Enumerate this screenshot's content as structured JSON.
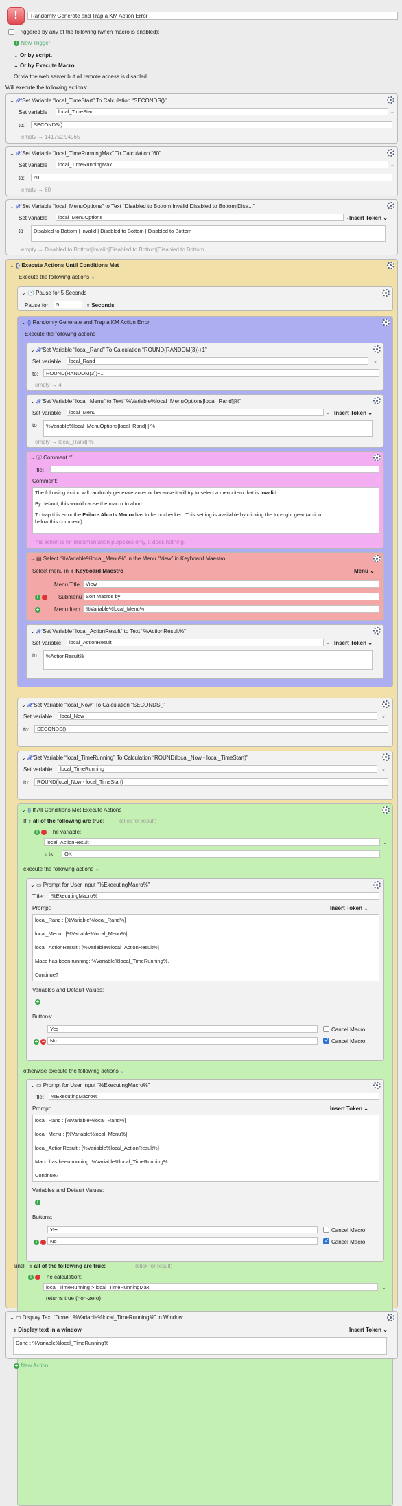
{
  "macro": {
    "name": "Randomly Generate and Trap a KM Action Error",
    "triggered_label": "Triggered by any of the following (when macro is enabled):",
    "new_trigger": "New Trigger",
    "or_by_script": "Or by script.",
    "or_by_execute": "Or by Execute Macro",
    "web_server_note": "Or via the web server but all remote access is disabled.",
    "will_execute": "Will execute the following actions:",
    "new_action": "New Action"
  },
  "actions": {
    "a1": {
      "title": "Set Variable “local_TimeStart” To Calculation “SECONDS()”",
      "set_label": "Set variable",
      "var": "local_TimeStart",
      "to_label": "to:",
      "value": "SECONDS()",
      "result": "empty → 141752.94965"
    },
    "a2": {
      "title": "Set Variable “local_TimeRunningMax” To Calculation “60”",
      "set_label": "Set variable",
      "var": "local_TimeRunningMax",
      "to_label": "to:",
      "value": "60",
      "result": "empty → 60"
    },
    "a3": {
      "title": "Set Variable “local_MenuOptions” to Text “Disabled to Bottom|Invalid|Disabled to Bottom|Disa...”",
      "set_label": "Set variable",
      "var": "local_MenuOptions",
      "insert": "Insert Token",
      "to_label": "to",
      "value": "Disabled to Bottom | Invalid | Disabled to Bottom | Disabled to Bottom",
      "result": "empty → Disabled to Bottom|Invalid|Disabled to Bottom|Disabled to Bottom"
    },
    "until": {
      "title": "Execute Actions Until Conditions Met",
      "exec_label": "Execute the following actions",
      "until_label": "until",
      "all_label": "all of the following are true:",
      "click": "(click for result)",
      "calc_label": "The calculation:",
      "calc": "local_TimeRunning > local_TimeRunningMax",
      "returns": "returns true (non-zero)"
    },
    "pause": {
      "title": "Pause for 5 Seconds",
      "label": "Pause for",
      "value": "5",
      "unit": "Seconds"
    },
    "group": {
      "title": "Randomly Generate and Trap a KM Action Error",
      "exec_label": "Execute the following actions"
    },
    "rand": {
      "title": "Set Variable “local_Rand” To Calculation “ROUND(RANDOM(3))+1”",
      "set_label": "Set variable",
      "var": "local_Rand",
      "to_label": "to:",
      "value": "ROUND(RANDOM(3))+1",
      "result": "empty → 4"
    },
    "menu": {
      "title": "Set Variable “local_Menu” to Text “%Variable%local_MenuOptions[local_Rand]|%”",
      "set_label": "Set variable",
      "var": "local_Menu",
      "insert": "Insert Token",
      "to_label": "to",
      "value": "%Variable%local_MenuOptions[local_Rand] | %",
      "result": "empty → local_Rand]|%"
    },
    "comment": {
      "title": "Comment “”",
      "title_label": "Title:",
      "comment_label": "Comment:",
      "line1_a": "The following action will randomly generate an error because it will try to select a menu item that is ",
      "line1_b": "Invalid",
      "line1_c": ".",
      "line2": "By default, this would cause the macro to abort.",
      "line3_a": "To trap this error the ",
      "line3_b": "Failure Aborts Macro",
      "line3_c": " has to be unchecked. This setting is available by clicking the top-right gear (action",
      "line3_d": "below this comment).",
      "footer": "This action is for documentation purposes only, it does nothing."
    },
    "select": {
      "title": "Select “%Variable%local_Menu%” in the Menu “View” in Keyboard Maestro",
      "select_label": "Select menu in",
      "app": "Keyboard Maestro",
      "menu_btn": "Menu",
      "title_label": "Menu Title",
      "title_val": "View",
      "sub_label": "Submenu",
      "sub_val": "Sort Macros by",
      "item_label": "Menu Item",
      "item_val": "%Variable%local_Menu%"
    },
    "result": {
      "title": "Set Variable “local_ActionResult” to Text “%ActionResult%”",
      "set_label": "Set variable",
      "var": "local_ActionResult",
      "insert": "Insert Token",
      "to_label": "to",
      "value": "%ActionResult%"
    },
    "now": {
      "title": "Set Variable “local_Now” To Calculation “SECONDS()”",
      "set_label": "Set variable",
      "var": "local_Now",
      "to_label": "to:",
      "value": "SECONDS()"
    },
    "running": {
      "title": "Set Variable “local_TimeRunning” To Calculation “ROUND(local_Now - local_TimeStart)”",
      "set_label": "Set variable",
      "var": "local_TimeRunning",
      "to_label": "to:",
      "value": "ROUND(local_Now - local_TimeStart)"
    },
    "ifthen": {
      "title": "If All Conditions Met Execute Actions",
      "if_label": "If",
      "all_label": "all of the following are true:",
      "click": "(click for result)",
      "var_label": "The variable:",
      "var": "local_ActionResult",
      "is_label": "is",
      "is_val": "OK",
      "exec_label": "execute the following actions",
      "otherwise_label": "otherwise execute the following actions"
    },
    "prompt1": {
      "title": "Prompt for User Input “%ExecutingMacro%”",
      "title_label": "Title:",
      "title_val": "%ExecutingMacro%",
      "prompt_label": "Prompt:",
      "insert": "Insert Token",
      "lines": [
        "local_Rand : [%Variable%local_Rand%]",
        "local_Menu : [%Variable%local_Menu%]",
        "local_ActionResult : [%Variable%local_ActionResult%]",
        "Maco has been running: %Variable%local_TimeRunning%.",
        "Continue?"
      ],
      "vars_label": "Variables and Default Values:",
      "buttons_label": "Buttons:",
      "btn1": "Yes",
      "btn2": "No",
      "cancel": "Cancel Macro"
    },
    "prompt2": {
      "title": "Prompt for User Input “%ExecutingMacro%”",
      "title_label": "Title:",
      "title_val": "%ExecutingMacro%",
      "prompt_label": "Prompt:",
      "insert": "Insert Token",
      "lines": [
        "local_Rand : [%Variable%local_Rand%]",
        "local_Menu : [%Variable%local_Menu%]",
        "local_ActionResult : [%Variable%local_ActionResult%]",
        "Maco has been running: %Variable%local_TimeRunning%.",
        "Continue?"
      ],
      "vars_label": "Variables and Default Values:",
      "buttons_label": "Buttons:",
      "btn1": "Yes",
      "btn2": "No",
      "cancel": "Cancel Macro"
    },
    "display": {
      "title": "Display Text “Done : %Variable%local_TimeRunning%” in Window",
      "mode": "Display text in a window",
      "insert": "Insert Token",
      "value": "Done : %Variable%local_TimeRunning%"
    }
  },
  "colors": {
    "until_bg": "#f1e0a8",
    "group_bg": "#adadf2",
    "comment_bg": "#f2aef0",
    "select_bg": "#f3a7a7",
    "if_bg": "#c5f0b4"
  }
}
